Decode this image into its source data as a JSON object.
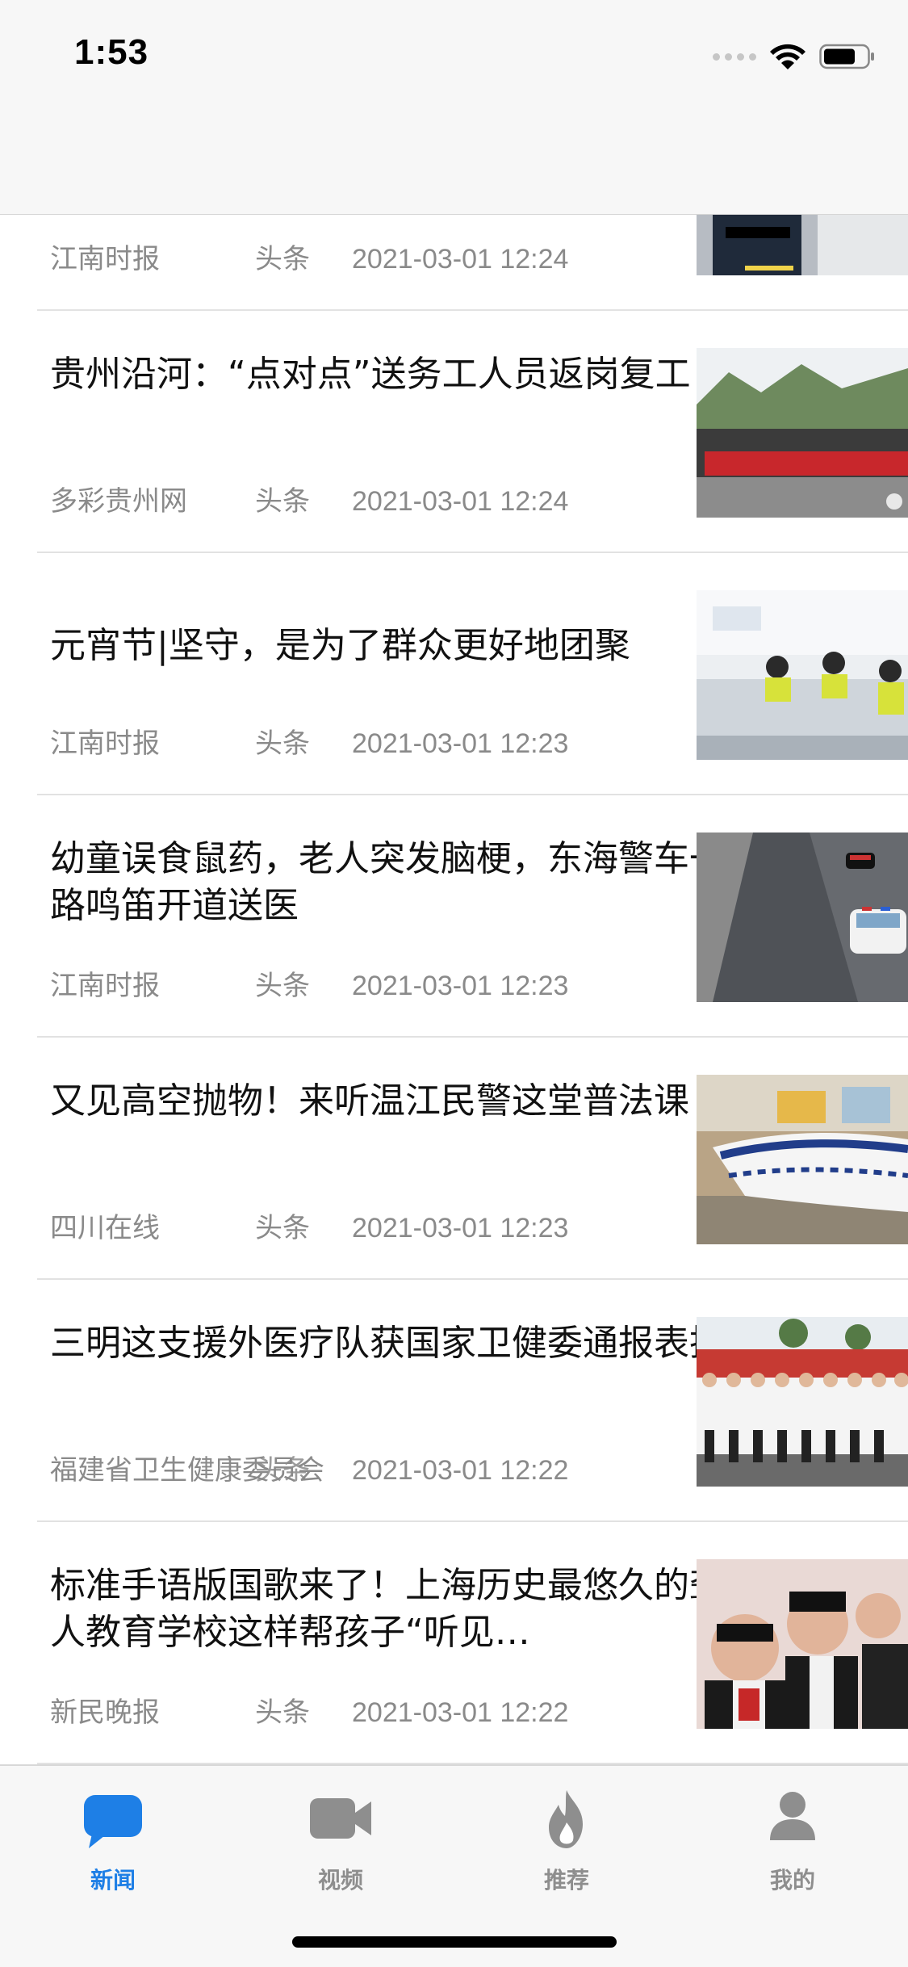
{
  "status_bar": {
    "time": "1:53"
  },
  "news": [
    {
      "title": "",
      "source": "江南时报",
      "tag": "头条",
      "date": "2021-03-01 12:24",
      "image": "police-officer-partial"
    },
    {
      "title": "贵州沿河：“点对点”送务工人员返岗复工",
      "source": "多彩贵州网",
      "tag": "头条",
      "date": "2021-03-01 12:24",
      "image": "crowd-with-banner"
    },
    {
      "title": "元宵节|坚守，是为了群众更好地团聚",
      "source": "江南时报",
      "tag": "头条",
      "date": "2021-03-01 12:23",
      "image": "office-service-hall"
    },
    {
      "title": "幼童误食鼠药，老人突发脑梗，东海警车一路鸣笛开道送医",
      "source": "江南时报",
      "tag": "头条",
      "date": "2021-03-01 12:23",
      "image": "police-car-on-road"
    },
    {
      "title": "又见高空抛物！来听温江民警这堂普法课",
      "source": "四川在线",
      "tag": "头条",
      "date": "2021-03-01 12:23",
      "image": "broken-bowl"
    },
    {
      "title": "三明这支援外医疗队获国家卫健委通报表扬",
      "source": "福建省卫生健康委员会",
      "tag": "头条",
      "date": "2021-03-01 12:22",
      "image": "medical-team-group"
    },
    {
      "title": "标准手语版国歌来了！上海历史最悠久的聋人教育学校这样帮孩子“听见…",
      "source": "新民晚报",
      "tag": "头条",
      "date": "2021-03-01 12:22",
      "image": "students-signing"
    }
  ],
  "tabs": [
    {
      "label": "新闻",
      "icon": "chat-bubble-icon",
      "active": true
    },
    {
      "label": "视频",
      "icon": "video-camera-icon",
      "active": false
    },
    {
      "label": "推荐",
      "icon": "flame-icon",
      "active": false
    },
    {
      "label": "我的",
      "icon": "person-icon",
      "active": false
    }
  ],
  "colors": {
    "accent": "#1e7fe6",
    "inactive": "#8e8e8e",
    "meta": "#8a8a8a"
  }
}
